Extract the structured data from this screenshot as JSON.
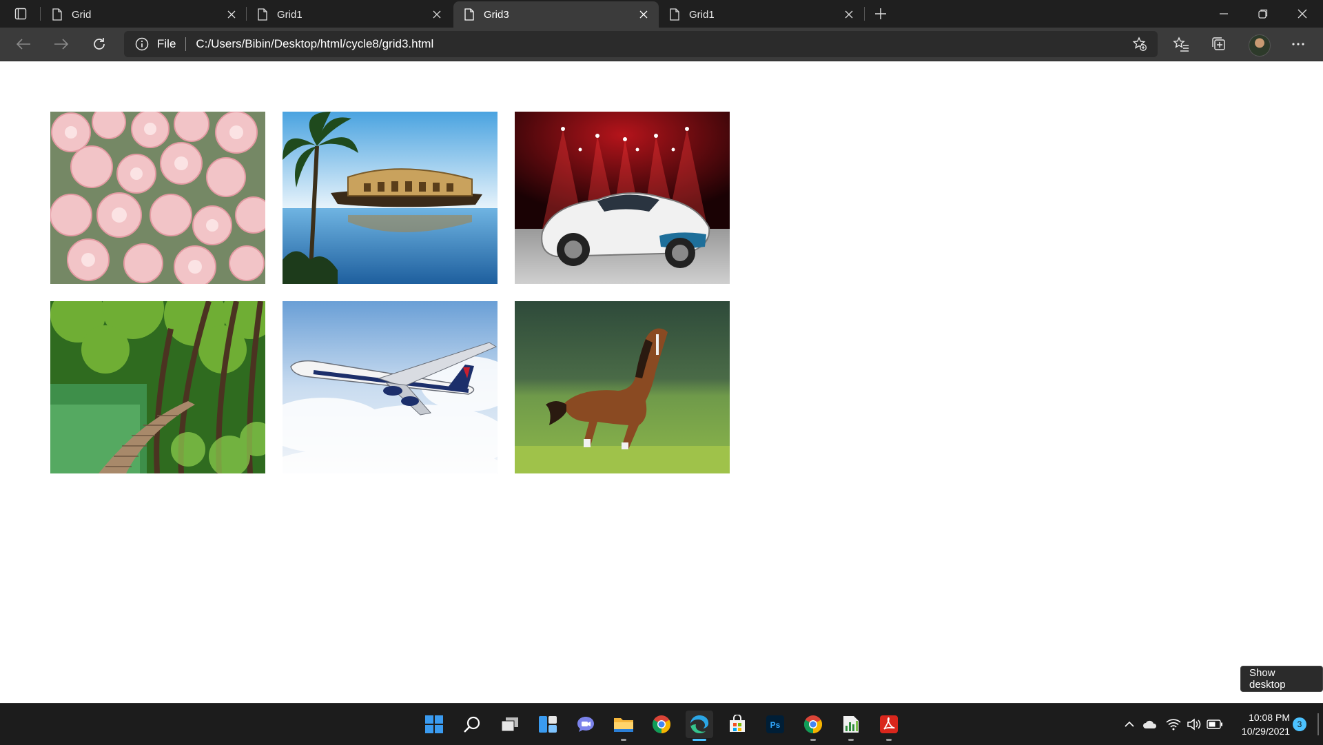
{
  "browser": {
    "tabs": [
      {
        "label": "Grid",
        "active": false
      },
      {
        "label": "Grid1",
        "active": false
      },
      {
        "label": "Grid3",
        "active": true
      },
      {
        "label": "Grid1",
        "active": false
      }
    ],
    "address": {
      "scheme_label": "File",
      "url": "C:/Users/Bibin/Desktop/html/cycle8/grid3.html"
    }
  },
  "page": {
    "images": [
      {
        "subject": "pink roses"
      },
      {
        "subject": "houseboat on backwaters with palm tree"
      },
      {
        "subject": "white sports car under red stage lights"
      },
      {
        "subject": "wooden boardwalk through green forest by lake"
      },
      {
        "subject": "airliner flying above clouds"
      },
      {
        "subject": "brown horse galloping on grass"
      }
    ]
  },
  "tooltip": {
    "text": "Show desktop"
  },
  "taskbar": {
    "apps": [
      "start-icon",
      "search-icon",
      "task-view-icon",
      "widgets-icon",
      "chat-icon",
      "file-explorer-icon",
      "chrome-icon",
      "edge-icon",
      "store-icon",
      "photoshop-icon",
      "chrome-icon",
      "charts-app-icon",
      "acrobat-icon"
    ],
    "time": "10:08 PM",
    "date": "10/29/2021",
    "notification_count": "3"
  },
  "colors": {
    "titlebar": "#1f1f1f",
    "toolbar": "#3b3b3b",
    "taskbar": "#1c1c1c",
    "accent": "#4cc2ff"
  }
}
